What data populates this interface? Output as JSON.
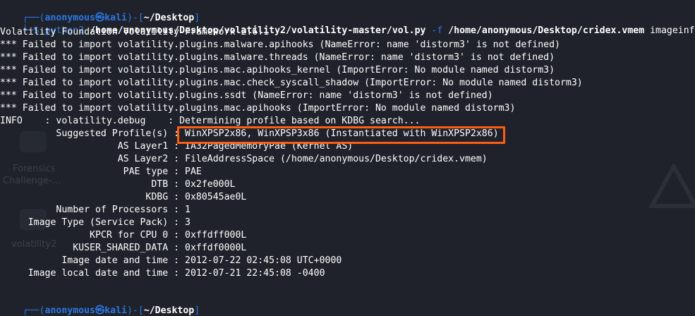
{
  "desktop": {
    "icons": [
      {
        "name": "forensics-challenge",
        "label_line1": "Forensics",
        "label_line2": "Challenge-..."
      },
      {
        "name": "volatility2",
        "label_line1": "volatility2"
      }
    ]
  },
  "prompt": {
    "user": "anonymous",
    "at": "㉿",
    "host": "kali",
    "dir": "~/Desktop",
    "top_prefix": "┌──(",
    "mid": ")-[",
    "top_suffix": "]",
    "bottom_prefix": "└─",
    "dollar": "$"
  },
  "command": {
    "program": "python2",
    "script": "/home/anonymous/Desktop/volatility2/volatility-master/vol.py",
    "flag": "-f",
    "file": "/home/anonymous/Desktop/cridex.vmem",
    "plugin": "imageinfo"
  },
  "output": {
    "banner": "Volatility Foundation Volatility Framework 2.6.1",
    "errors": [
      "*** Failed to import volatility.plugins.malware.apihooks (NameError: name 'distorm3' is not defined)",
      "*** Failed to import volatility.plugins.malware.threads (NameError: name 'distorm3' is not defined)",
      "*** Failed to import volatility.plugins.mac.apihooks_kernel (ImportError: No module named distorm3)",
      "*** Failed to import volatility.plugins.mac.check_syscall_shadow (ImportError: No module named distorm3)",
      "*** Failed to import volatility.plugins.ssdt (NameError: name 'distorm3' is not defined)",
      "*** Failed to import volatility.plugins.mac.apihooks (ImportError: No module named distorm3)"
    ],
    "info_line": "INFO    : volatility.debug    : Determining profile based on KDBG search...",
    "rows": [
      {
        "label": "          Suggested Profile(s)",
        "value": "WinXPSP2x86, WinXPSP3x86 (Instantiated with WinXPSP2x86)"
      },
      {
        "label": "                     AS Layer1",
        "value": "IA32PagedMemoryPae (Kernel AS)"
      },
      {
        "label": "                     AS Layer2",
        "value": "FileAddressSpace (/home/anonymous/Desktop/cridex.vmem)"
      },
      {
        "label": "                      PAE type",
        "value": "PAE"
      },
      {
        "label": "                           DTB",
        "value": "0x2fe000L"
      },
      {
        "label": "                          KDBG",
        "value": "0x80545ae0L"
      },
      {
        "label": "          Number of Processors",
        "value": "1"
      },
      {
        "label": "     Image Type (Service Pack)",
        "value": "3"
      },
      {
        "label": "                KPCR for CPU 0",
        "value": "0xffdff000L"
      },
      {
        "label": "             KUSER_SHARED_DATA",
        "value": "0xffdf0000L"
      },
      {
        "label": "           Image date and time",
        "value": "2012-07-22 02:45:08 UTC+0000"
      },
      {
        "label": "     Image local date and time",
        "value": "2012-07-21 22:45:08 -0400"
      }
    ],
    "separator": " : "
  },
  "colors": {
    "background": "#1e2129",
    "prompt_blue": "#2b78e4",
    "highlight_orange": "#ff5d12",
    "text": "#ffffff"
  }
}
